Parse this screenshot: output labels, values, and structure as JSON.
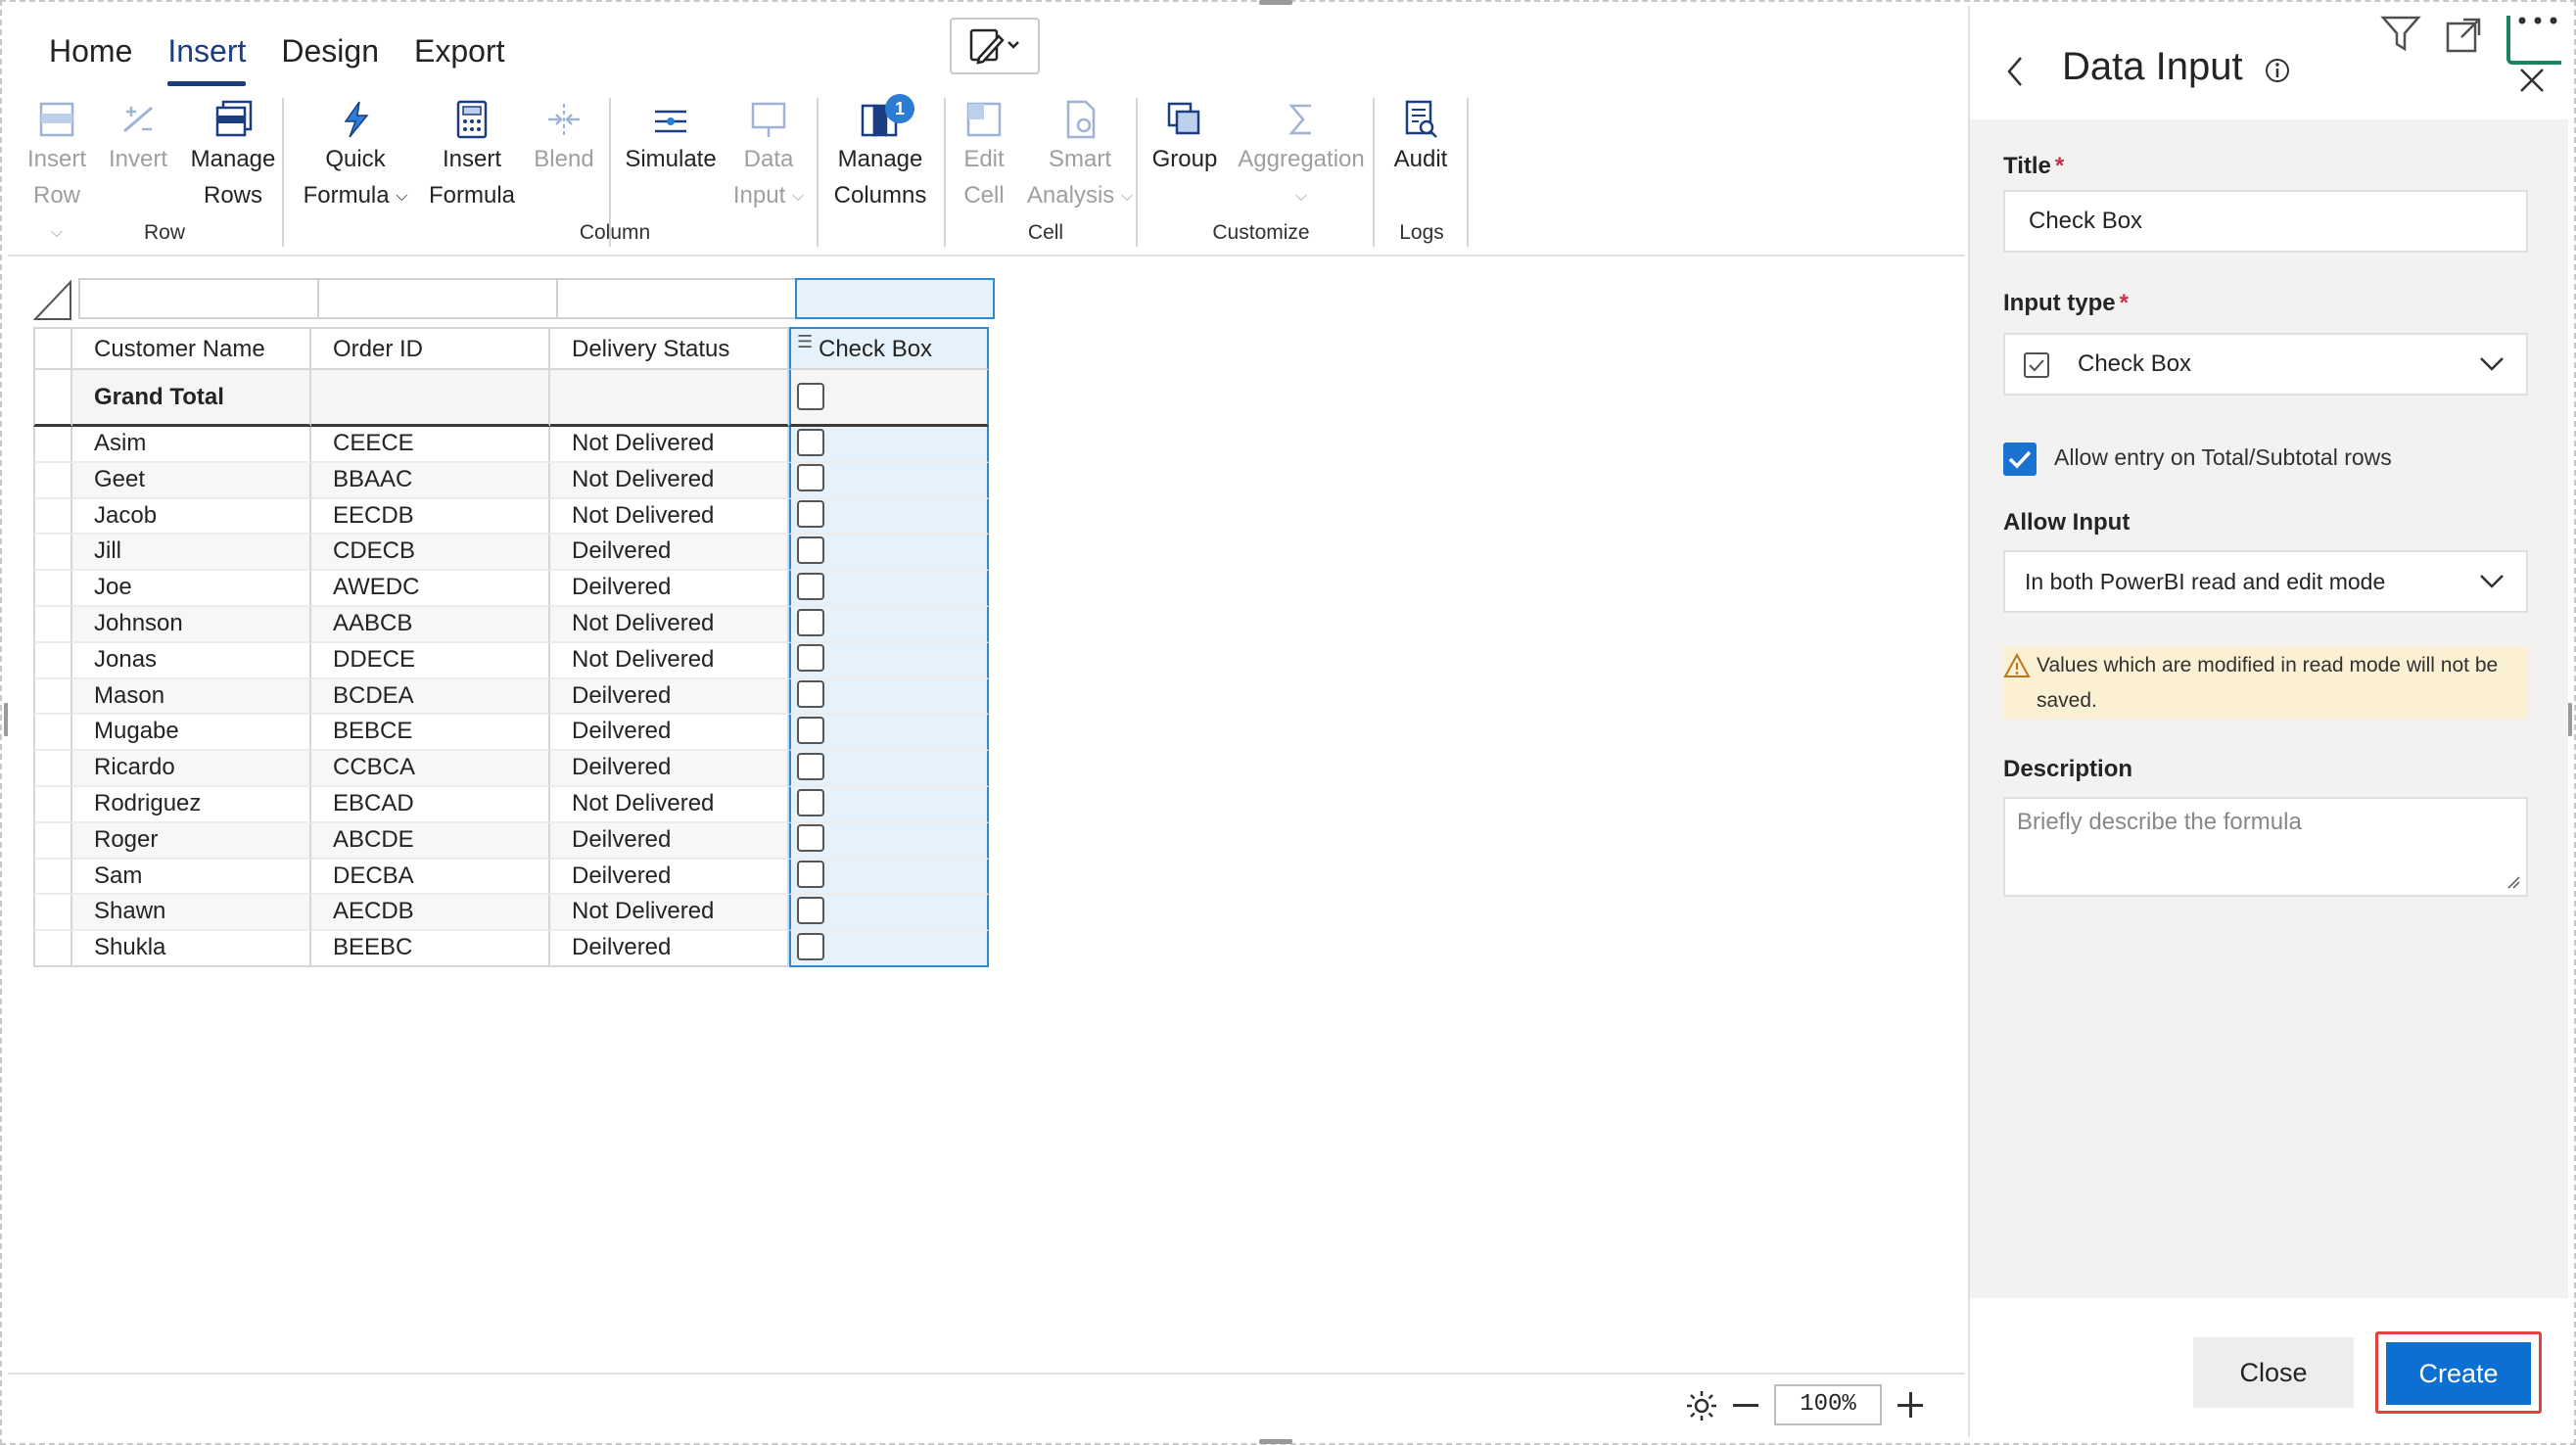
{
  "menu": {
    "tabs": [
      {
        "label": "Home"
      },
      {
        "label": "Insert"
      },
      {
        "label": "Design"
      },
      {
        "label": "Export"
      }
    ],
    "active_tab": "Insert"
  },
  "ribbon": {
    "insert_row": {
      "line1": "Insert",
      "line2": "Row"
    },
    "invert": {
      "line1": "Invert"
    },
    "manage_rows": {
      "line1": "Manage",
      "line2": "Rows"
    },
    "quick_formula": {
      "line1": "Quick",
      "line2": "Formula"
    },
    "insert_formula": {
      "line1": "Insert",
      "line2": "Formula"
    },
    "blend": {
      "line1": "Blend"
    },
    "simulate": {
      "line1": "Simulate"
    },
    "data_input": {
      "line1": "Data",
      "line2": "Input"
    },
    "manage_columns": {
      "line1": "Manage",
      "line2": "Columns",
      "badge": "1"
    },
    "edit_cell": {
      "line1": "Edit",
      "line2": "Cell"
    },
    "smart_analysis": {
      "line1": "Smart",
      "line2": "Analysis"
    },
    "group": {
      "line1": "Group"
    },
    "aggregation": {
      "line1": "Aggregation"
    },
    "audit": {
      "line1": "Audit"
    },
    "groups": {
      "row": "Row",
      "column": "Column",
      "cell": "Cell",
      "customize": "Customize",
      "logs": "Logs"
    }
  },
  "table": {
    "headers": [
      "Customer Name",
      "Order ID",
      "Delivery Status",
      "Check Box"
    ],
    "grand_total": "Grand Total",
    "rows": [
      {
        "name": "Asim",
        "order": "CEECE",
        "status": "Not Delivered"
      },
      {
        "name": "Geet",
        "order": "BBAAC",
        "status": "Not Delivered"
      },
      {
        "name": "Jacob",
        "order": "EECDB",
        "status": "Not Delivered"
      },
      {
        "name": "Jill",
        "order": "CDECB",
        "status": "Deilvered"
      },
      {
        "name": "Joe",
        "order": "AWEDC",
        "status": "Deilvered"
      },
      {
        "name": "Johnson",
        "order": "AABCB",
        "status": "Not Delivered"
      },
      {
        "name": "Jonas",
        "order": "DDECE",
        "status": "Not Delivered"
      },
      {
        "name": "Mason",
        "order": "BCDEA",
        "status": "Deilvered"
      },
      {
        "name": "Mugabe",
        "order": "BEBCE",
        "status": "Deilvered"
      },
      {
        "name": "Ricardo",
        "order": "CCBCA",
        "status": "Deilvered"
      },
      {
        "name": "Rodriguez",
        "order": "EBCAD",
        "status": "Not Delivered"
      },
      {
        "name": "Roger",
        "order": "ABCDE",
        "status": "Deilvered"
      },
      {
        "name": "Sam",
        "order": "DECBA",
        "status": "Deilvered"
      },
      {
        "name": "Shawn",
        "order": "AECDB",
        "status": "Not Delivered"
      },
      {
        "name": "Shukla",
        "order": "BEEBC",
        "status": "Deilvered"
      }
    ]
  },
  "statusbar": {
    "zoom": "100%"
  },
  "panel": {
    "title": "Data Input",
    "title_field": {
      "label": "Title",
      "required_mark": "*",
      "value": "Check Box"
    },
    "input_type": {
      "label": "Input type",
      "required_mark": "*",
      "value": "Check Box"
    },
    "allow_total": {
      "label": "Allow entry on Total/Subtotal rows",
      "checked": true
    },
    "allow_input": {
      "label": "Allow Input",
      "value": "In both PowerBI read and edit mode"
    },
    "warning": "Values which are modified in read mode will not be saved.",
    "description": {
      "label": "Description",
      "placeholder": "Briefly describe the formula"
    },
    "close_label": "Close",
    "create_label": "Create"
  },
  "colors": {
    "accent": "#1b3d82",
    "primary_button": "#0e6fd2",
    "selection": "#e5f2fb",
    "warning_bg": "#fbf0d4",
    "highlight_border": "#e0443e",
    "brand_green": "#17845b"
  }
}
